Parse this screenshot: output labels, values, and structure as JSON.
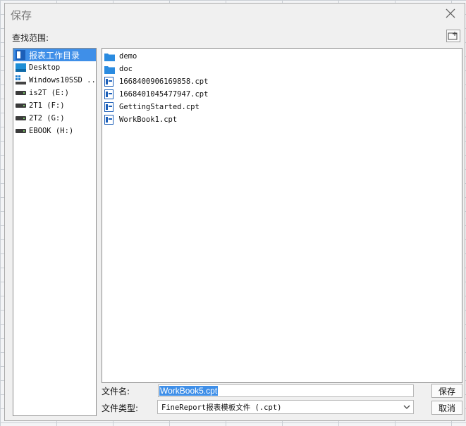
{
  "dialog": {
    "title": "保存",
    "scope_label": "查找范围:",
    "filename_label": "文件名:",
    "filename_value": "WorkBook5.cpt",
    "filetype_label": "文件类型:",
    "filetype_value": "FineReport报表模板文件 (.cpt)",
    "save_button": "保存",
    "cancel_button": "取消"
  },
  "left_items": [
    {
      "label": "报表工作目录",
      "icon": "report-dir-icon",
      "selected": true
    },
    {
      "label": "Desktop",
      "icon": "desktop-icon"
    },
    {
      "label": "Windows10SSD ...",
      "icon": "windows-drive-icon"
    },
    {
      "label": "is2T (E:)",
      "icon": "drive-icon"
    },
    {
      "label": "2T1 (F:)",
      "icon": "drive-icon"
    },
    {
      "label": "2T2 (G:)",
      "icon": "drive-icon"
    },
    {
      "label": "EBOOK (H:)",
      "icon": "drive-icon"
    }
  ],
  "files": [
    {
      "name": "demo",
      "icon": "folder-icon"
    },
    {
      "name": "doc",
      "icon": "folder-icon"
    },
    {
      "name": "1668400906169858.cpt",
      "icon": "cpt-file-icon"
    },
    {
      "name": "1668401045477947.cpt",
      "icon": "cpt-file-icon"
    },
    {
      "name": "GettingStarted.cpt",
      "icon": "cpt-file-icon"
    },
    {
      "name": "WorkBook1.cpt",
      "icon": "cpt-file-icon"
    }
  ]
}
